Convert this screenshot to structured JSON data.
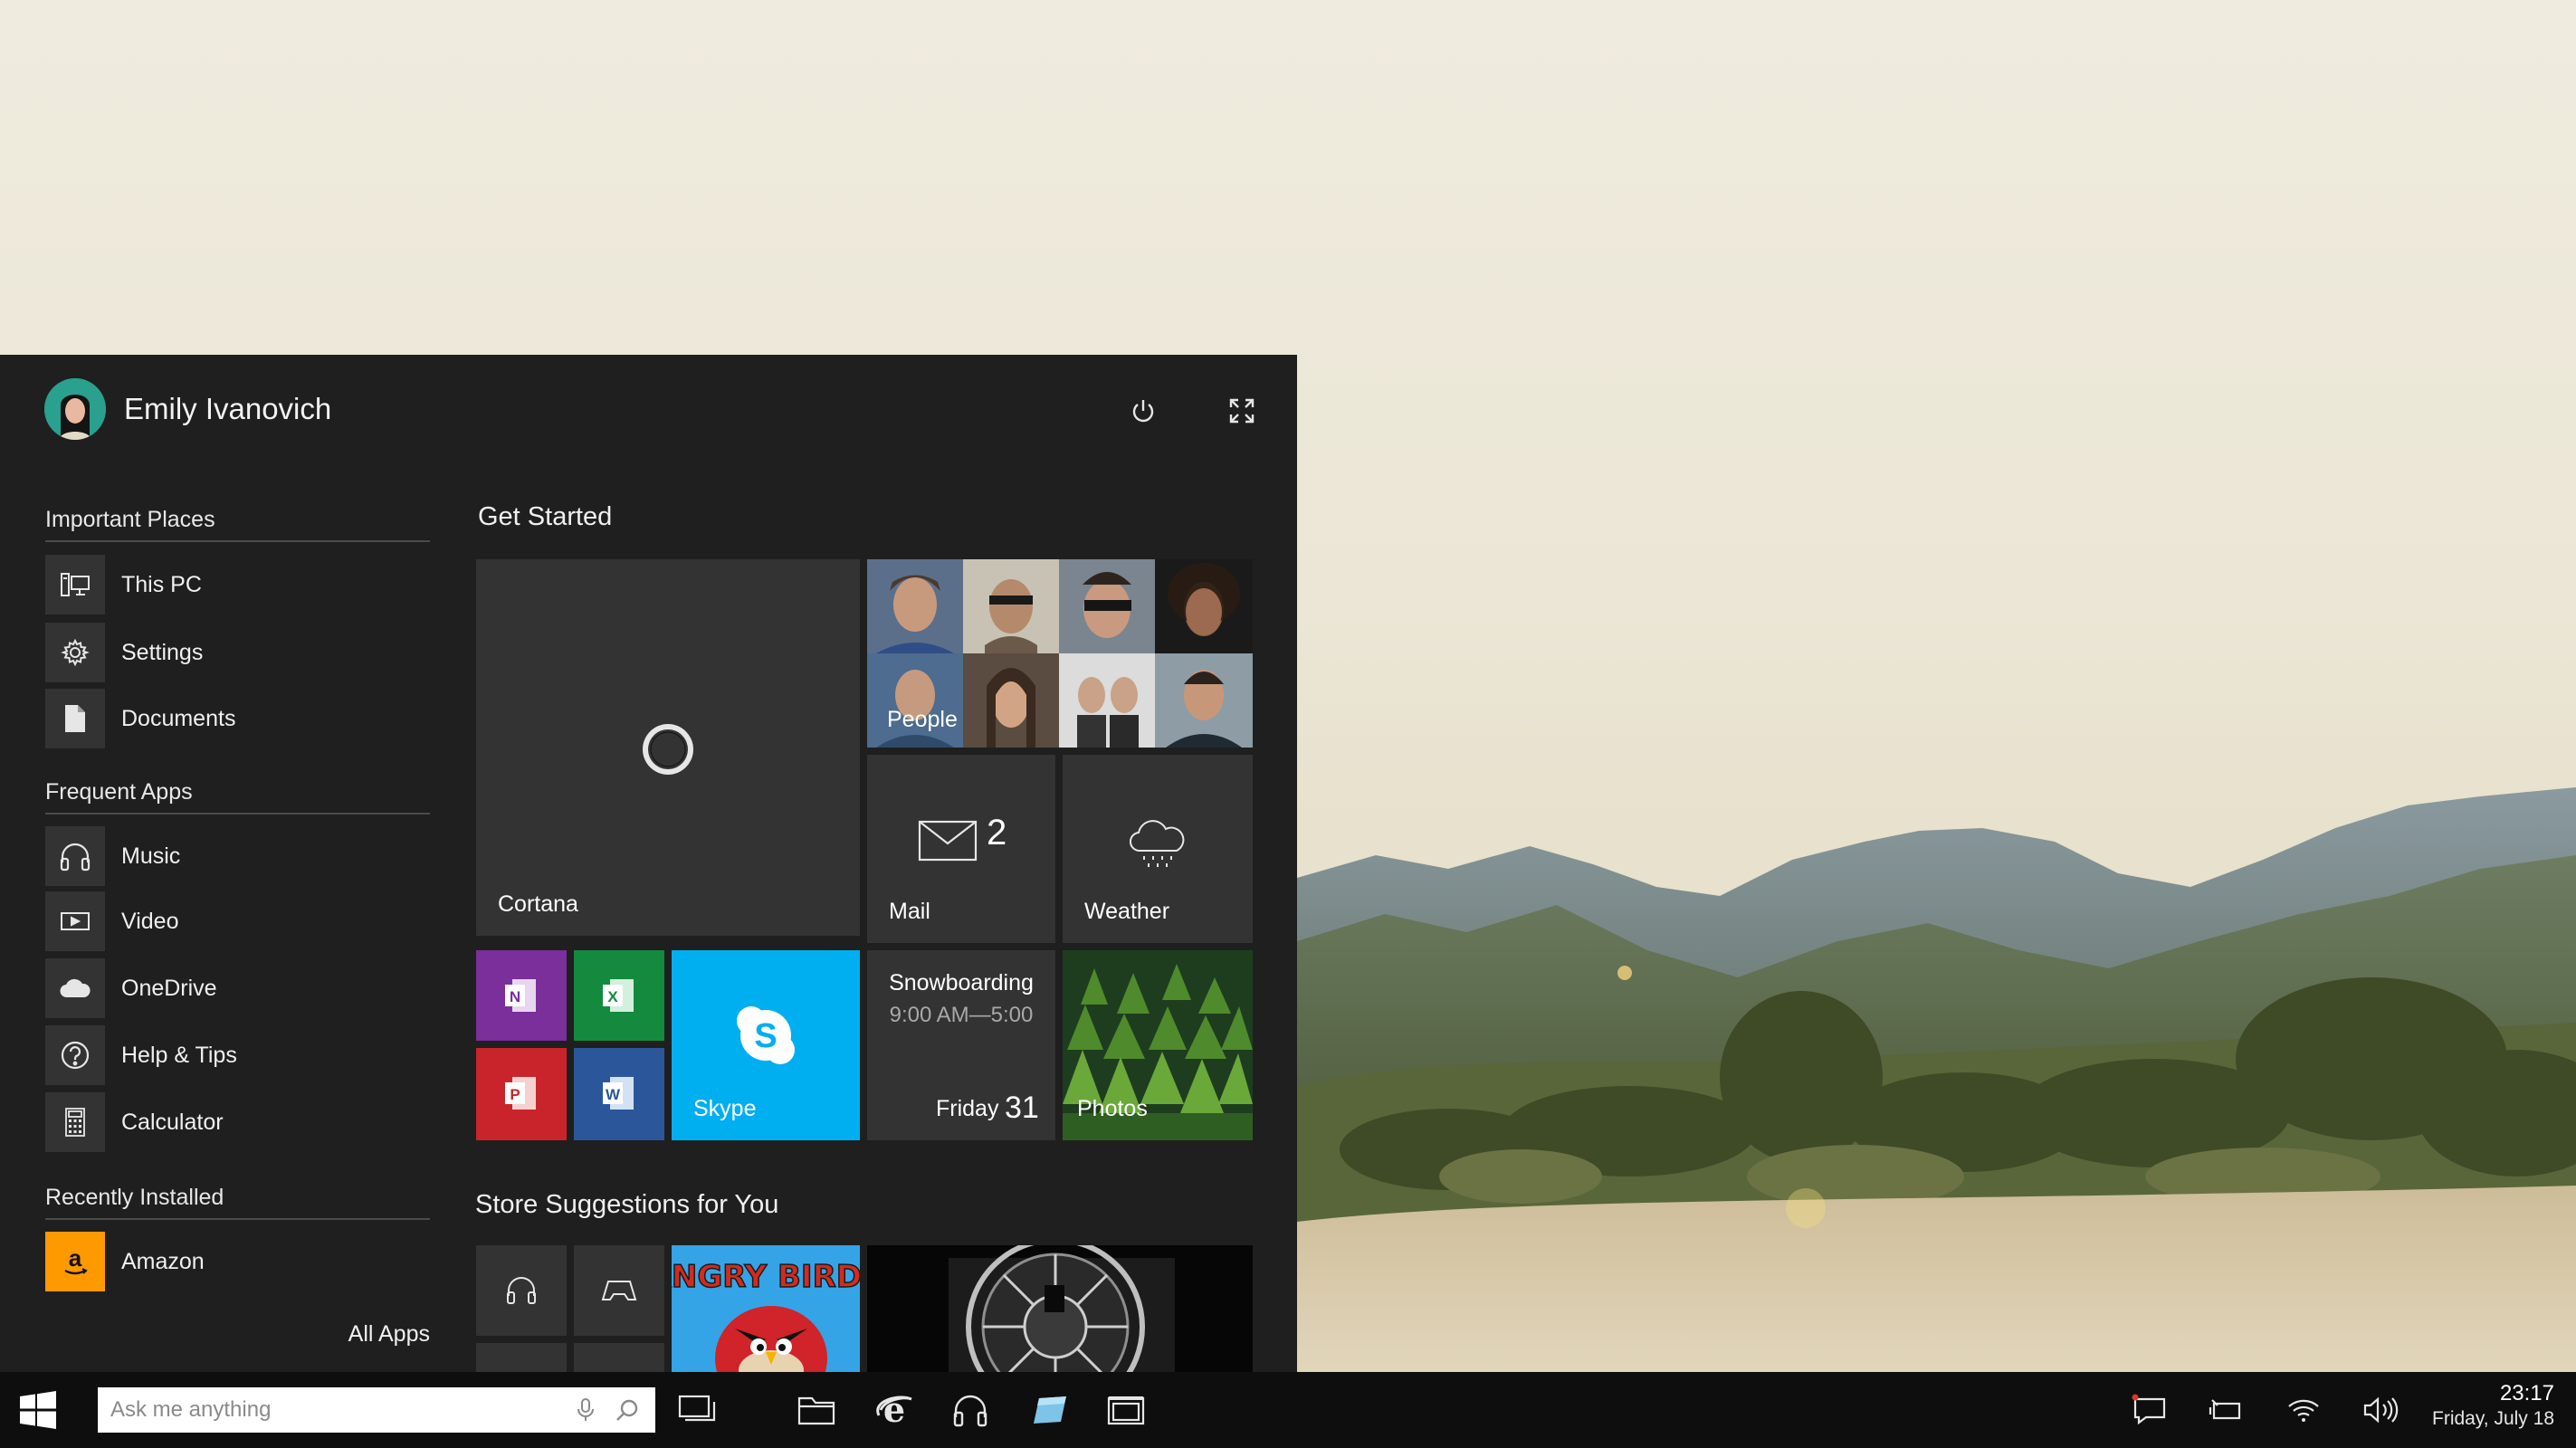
{
  "user": {
    "name": "Emily Ivanovich"
  },
  "sections": {
    "important_places": "Important Places",
    "frequent_apps": "Frequent Apps",
    "recently_installed": "Recently Installed"
  },
  "important_places": [
    {
      "label": "This PC",
      "icon": "pc-icon"
    },
    {
      "label": "Settings",
      "icon": "gear-icon"
    },
    {
      "label": "Documents",
      "icon": "document-icon"
    }
  ],
  "frequent_apps": [
    {
      "label": "Music",
      "icon": "headphones-icon"
    },
    {
      "label": "Video",
      "icon": "video-icon"
    },
    {
      "label": "OneDrive",
      "icon": "cloud-icon"
    },
    {
      "label": "Help & Tips",
      "icon": "help-icon"
    },
    {
      "label": "Calculator",
      "icon": "calculator-icon"
    }
  ],
  "recently_installed": [
    {
      "label": "Amazon",
      "icon": "amazon-icon"
    }
  ],
  "all_apps": "All Apps",
  "groups": {
    "get_started": "Get Started",
    "store": "Store Suggestions for You"
  },
  "tiles": {
    "cortana": "Cortana",
    "people": "People",
    "mail": "Mail",
    "mail_count": "2",
    "weather": "Weather",
    "skype": "Skype",
    "calendar_event": "Snowboarding",
    "calendar_time": "9:00 AM—5:00",
    "calendar_day": "Friday",
    "calendar_date": "31",
    "photos": "Photos",
    "store_game_title": "ANGRY BIRDS"
  },
  "search": {
    "placeholder": "Ask me anything"
  },
  "clock": {
    "time": "23:17",
    "date": "Friday, July 18"
  },
  "colors": {
    "onenote": "#7b2f9a",
    "excel": "#138a3e",
    "powerpoint": "#c9242b",
    "word": "#2b579a",
    "skype": "#00aff0",
    "amazon": "#ff9900"
  }
}
